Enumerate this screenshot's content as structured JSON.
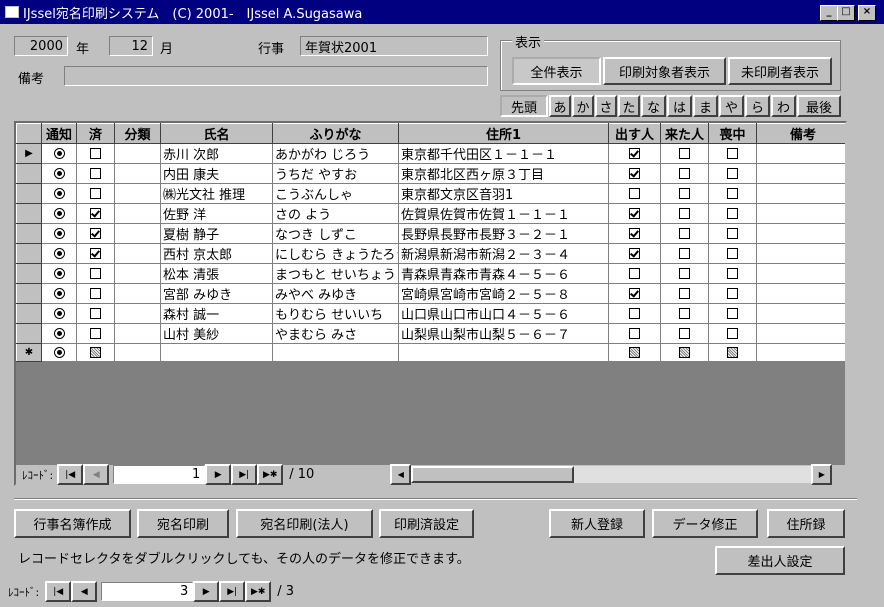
{
  "window": {
    "title": "IJssel宛名印刷システム　(C) 2001-　IJssel A.Sugasawa"
  },
  "header": {
    "year_value": "2000",
    "year_label": "年",
    "month_value": "12",
    "month_label": "月",
    "event_label": "行事",
    "event_value": "年賀状2001",
    "note_label": "備考",
    "note_value": ""
  },
  "display_group": {
    "label": "表示",
    "buttons": [
      "全件表示",
      "印刷対象者表示",
      "未印刷者表示"
    ]
  },
  "index_tabs": [
    "先頭",
    "あ",
    "か",
    "さ",
    "た",
    "な",
    "は",
    "ま",
    "や",
    "ら",
    "わ",
    "最後"
  ],
  "grid": {
    "columns": [
      "通知",
      "済",
      "分類",
      "氏名",
      "ふりがな",
      "住所1",
      "出す人",
      "来た人",
      "喪中",
      "備考"
    ],
    "rows": [
      {
        "name": "赤川 次郎",
        "kana": "あかがわ じろう",
        "address": "東京都千代田区１－１－１",
        "done": false,
        "send": true,
        "came": false,
        "mourning": false,
        "current": true
      },
      {
        "name": "内田 康夫",
        "kana": "うちだ やすお",
        "address": "東京都北区西ヶ原３丁目",
        "done": false,
        "send": true,
        "came": false,
        "mourning": false
      },
      {
        "name": "㈱光文社 推理",
        "kana": "こうぶんしゃ",
        "address": "東京都文京区音羽1",
        "done": false,
        "send": false,
        "came": false,
        "mourning": false
      },
      {
        "name": "佐野 洋",
        "kana": "さの よう",
        "address": "佐賀県佐賀市佐賀１－１－１",
        "done": true,
        "send": true,
        "came": false,
        "mourning": false
      },
      {
        "name": "夏樹 静子",
        "kana": "なつき しずこ",
        "address": "長野県長野市長野３－２－１",
        "done": true,
        "send": true,
        "came": false,
        "mourning": false
      },
      {
        "name": "西村 京太郎",
        "kana": "にしむら きょうたろう",
        "address": "新潟県新潟市新潟２－３－４",
        "done": true,
        "send": true,
        "came": false,
        "mourning": false
      },
      {
        "name": "松本 清張",
        "kana": "まつもと せいちょう",
        "address": "青森県青森市青森４－５－６",
        "done": false,
        "send": false,
        "came": false,
        "mourning": false
      },
      {
        "name": "宮部 みゆき",
        "kana": "みやべ みゆき",
        "address": "宮崎県宮崎市宮崎２－５－８",
        "done": false,
        "send": true,
        "came": false,
        "mourning": false
      },
      {
        "name": "森村 誠一",
        "kana": "もりむら せいいち",
        "address": "山口県山口市山口４－５－６",
        "done": false,
        "send": false,
        "came": false,
        "mourning": false
      },
      {
        "name": "山村 美紗",
        "kana": "やまむら みさ",
        "address": "山梨県山梨市山梨５－６－７",
        "done": false,
        "send": false,
        "came": false,
        "mourning": false
      }
    ]
  },
  "inner_nav": {
    "label": "ﾚｺｰﾄﾞ:",
    "current": "1",
    "total": "/ 10"
  },
  "bottom_buttons": [
    "行事名簿作成",
    "宛名印刷",
    "宛名印刷(法人)",
    "印刷済設定"
  ],
  "right_buttons": [
    "新人登録",
    "データ修正",
    "住所録",
    "差出人設定"
  ],
  "hint": "レコードセレクタをダブルクリックしても、その人のデータを修正できます。",
  "outer_nav": {
    "label": "ﾚｺｰﾄﾞ:",
    "current": "3",
    "total": "/ 3"
  }
}
